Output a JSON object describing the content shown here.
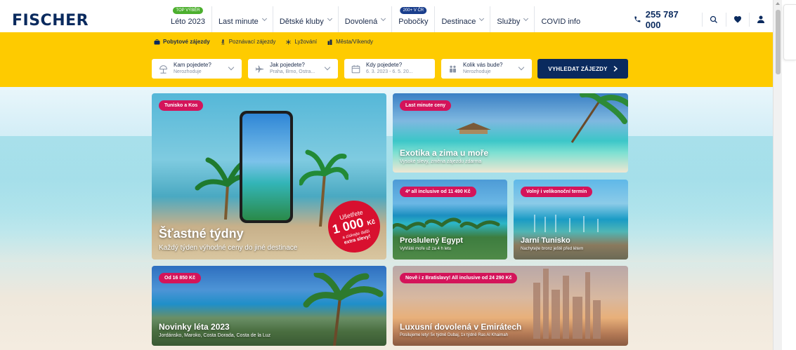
{
  "header": {
    "logo": "FISCHER",
    "nav": [
      {
        "label": "Léto 2023",
        "badge": "TOP VÝBĚR",
        "badge_color": "#4caf2e",
        "dropdown": false
      },
      {
        "label": "Last minute",
        "badge": "",
        "dropdown": true
      },
      {
        "label": "Dětské kluby",
        "badge": "",
        "dropdown": true
      },
      {
        "label": "Dovolená",
        "badge": "",
        "dropdown": true
      },
      {
        "label": "Pobočky",
        "badge": "200+ V ČR",
        "badge_color": "#1a3e8c",
        "dropdown": false
      },
      {
        "label": "Destinace",
        "badge": "",
        "dropdown": true
      },
      {
        "label": "Služby",
        "badge": "",
        "dropdown": true
      },
      {
        "label": "COVID info",
        "badge": "",
        "dropdown": false
      }
    ],
    "phone": "255 787 000",
    "icons": [
      "phone-icon",
      "search-icon",
      "heart-icon",
      "user-icon"
    ]
  },
  "search": {
    "tabs": [
      {
        "label": "Pobytové zájezdy",
        "icon": "suitcase-icon",
        "active": true
      },
      {
        "label": "Poznávací zájezdy",
        "icon": "hiker-icon",
        "active": false
      },
      {
        "label": "Lyžování",
        "icon": "snowflake-icon",
        "active": false
      },
      {
        "label": "Města/Víkendy",
        "icon": "city-icon",
        "active": false
      }
    ],
    "fields": [
      {
        "label": "Kam pojedete?",
        "value": "Nerozhoduje",
        "icon": "beach-umbrella-icon"
      },
      {
        "label": "Jak pojedete?",
        "value": "Praha, Brno, Ostra...",
        "icon": "plane-icon"
      },
      {
        "label": "Kdy pojedete?",
        "value": "6. 3. 2023 - 6. 5. 20...",
        "icon": "calendar-icon"
      },
      {
        "label": "Kolik vás bude?",
        "value": "Nerozhoduje",
        "icon": "people-icon"
      }
    ],
    "button": "VYHLEDAT ZÁJEZDY"
  },
  "cards": {
    "big": {
      "tag": "Tunisko a Kos",
      "title": "Šťastné týdny",
      "subtitle": "Každý týden výhodné ceny do jiné destinace",
      "promo": {
        "line1": "Ušetřete",
        "amount": "1 000",
        "currency": "Kč",
        "line3": "a získejte další",
        "line4": "extra slevy!"
      }
    },
    "last_minute": {
      "tag": "Last minute ceny",
      "title": "Exotika a zima u moře",
      "subtitle": "Vysoké slevy, změna zájezdu zdarma"
    },
    "egypt": {
      "tag": "4* all inclusive od 11 490 Kč",
      "title": "Proslulený Egypt",
      "subtitle": "Vyhřáté moře už za 4 h letu"
    },
    "tunisia": {
      "tag": "Volný i velikonoční termín",
      "title": "Jarní Tunisko",
      "subtitle": "Nachytejte bronz ještě před létem"
    },
    "news": {
      "tag": "Od 16 850 Kč",
      "title": "Novinky léta 2023",
      "subtitle": "Jordánsko, Maroko, Costa Dorada, Costa de la Luz"
    },
    "emirates": {
      "tag": "Nově i z Bratislavy! All inclusive od 24 290 Kč",
      "title": "Luxusní dovolená v Emirátech",
      "subtitle": "Posilujeme lety! 5x týdně Dubaj, 1x týdně Ras Al Khaimah"
    }
  },
  "colors": {
    "brand": "#0a2a5e",
    "yellow": "#fecb00",
    "tag": "#d4145a"
  }
}
